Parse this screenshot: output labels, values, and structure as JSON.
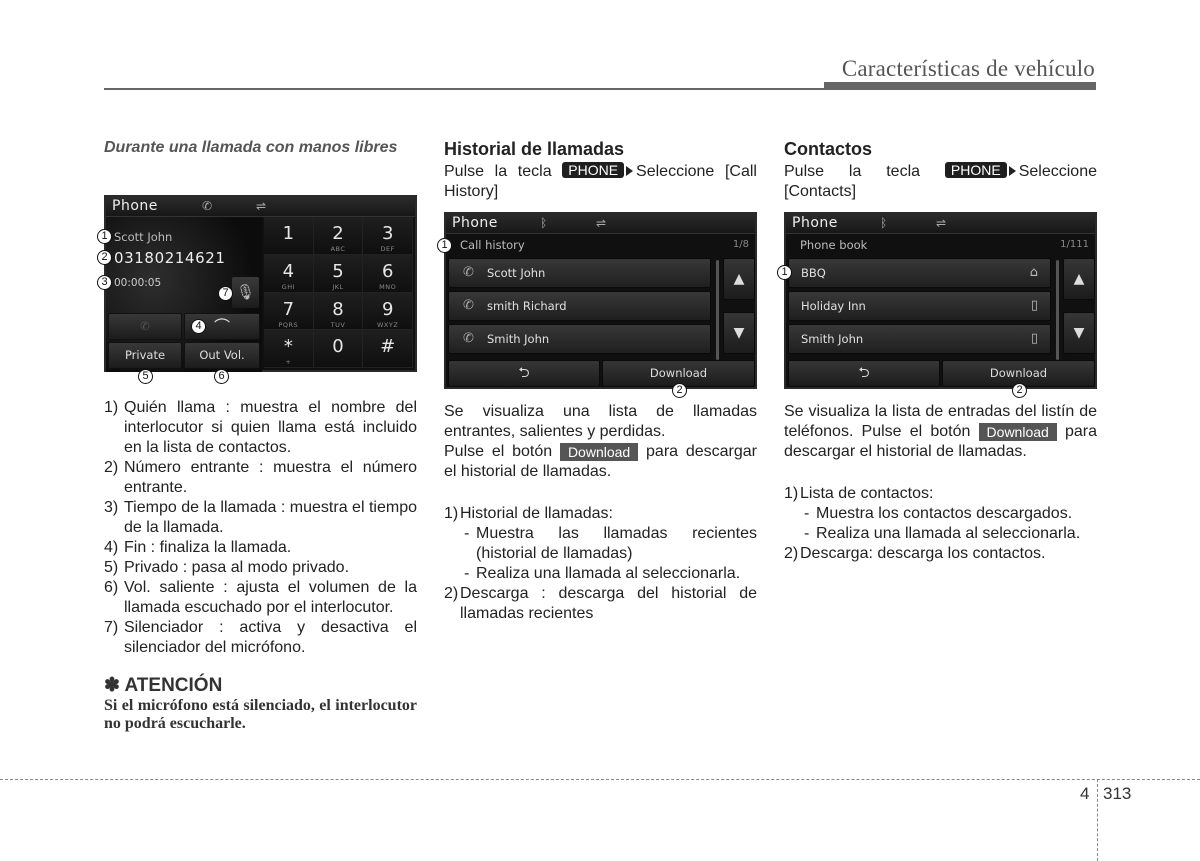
{
  "header": {
    "section_title": "Características de vehículo"
  },
  "col1": {
    "heading": "Durante una llamada con manos libres",
    "screen": {
      "title": "Phone",
      "caller_name": "Scott John",
      "caller_number": "03180214621",
      "call_time": "00:00:05",
      "buttons": {
        "private": "Private",
        "out_vol": "Out Vol."
      },
      "keypad": [
        {
          "digit": "1",
          "letters": ""
        },
        {
          "digit": "2",
          "letters": "ABC"
        },
        {
          "digit": "3",
          "letters": "DEF"
        },
        {
          "digit": "4",
          "letters": "GHI"
        },
        {
          "digit": "5",
          "letters": "JKL"
        },
        {
          "digit": "6",
          "letters": "MNO"
        },
        {
          "digit": "7",
          "letters": "PQRS"
        },
        {
          "digit": "8",
          "letters": "TUV"
        },
        {
          "digit": "9",
          "letters": "WXYZ"
        },
        {
          "digit": "*",
          "letters": "+"
        },
        {
          "digit": "0",
          "letters": ""
        },
        {
          "digit": "#",
          "letters": ""
        }
      ],
      "callouts": [
        "1",
        "2",
        "3",
        "4",
        "5",
        "6",
        "7"
      ]
    },
    "items": [
      {
        "n": "1)",
        "text": "Quién llama : muestra el nombre del interlocutor si quien llama está incluido en la lista de contactos."
      },
      {
        "n": "2)",
        "text": "Número entrante : muestra el número entrante."
      },
      {
        "n": "3)",
        "text": "Tiempo de la llamada : muestra el tiempo de la llamada."
      },
      {
        "n": "4)",
        "text": "Fin : finaliza la llamada."
      },
      {
        "n": "5)",
        "text": "Privado : pasa al modo privado."
      },
      {
        "n": "6)",
        "text": "Vol. saliente : ajusta el volumen de la llamada escuchado por el interlocutor."
      },
      {
        "n": "7)",
        "text": "Silenciador : activa y desactiva el silenciador del micrófono."
      }
    ],
    "attention": {
      "title": "✽ ATENCIÓN",
      "body": "Si el micrófono está silenciado, el interlocutor no podrá escucharle."
    }
  },
  "col2": {
    "heading": "Historial de llamadas",
    "intro_pre": "Pulse la tecla",
    "key": "PHONE",
    "intro_post": "Seleccione [Call History]",
    "screen": {
      "title": "Phone",
      "subtitle": "Call history",
      "count": "1/8",
      "rows": [
        "Scott John",
        "smith Richard",
        "Smith John"
      ],
      "download": "Download",
      "callouts": [
        "1",
        "2"
      ]
    },
    "desc1": "Se visualiza una lista de llamadas entrantes, salientes y perdidas.",
    "desc2_pre": "Pulse el botón",
    "desc2_btn": "Download",
    "desc2_post": "para descargar el historial de llamadas.",
    "items": [
      {
        "n": "1)",
        "text": "Historial de llamadas:",
        "subs": [
          "Muestra las llamadas recientes (historial de llamadas)",
          "Realiza una llamada al seleccionarla."
        ]
      },
      {
        "n": "2)",
        "text": "Descarga : descarga del historial de llamadas recientes"
      }
    ]
  },
  "col3": {
    "heading": "Contactos",
    "intro_pre": "Pulse la tecla",
    "key": "PHONE",
    "intro_post": "Seleccione [Contacts]",
    "screen": {
      "title": "Phone",
      "subtitle": "Phone book",
      "count": "1/111",
      "rows": [
        {
          "name": "BBQ",
          "icon": "home-icon"
        },
        {
          "name": "Holiday Inn",
          "icon": "mobile-icon"
        },
        {
          "name": "Smith John",
          "icon": "mobile-icon"
        }
      ],
      "download": "Download",
      "callouts": [
        "1",
        "2"
      ]
    },
    "desc_pre": "Se visualiza la lista de entradas del listín de teléfonos. Pulse el botón",
    "desc_btn": "Download",
    "desc_post": "para descargar el historial de llamadas.",
    "items": [
      {
        "n": "1)",
        "text": "Lista de contactos:",
        "subs": [
          "Muestra los contactos descargados.",
          "Realiza una llamada al seleccionarla."
        ]
      },
      {
        "n": "2)",
        "text": "Descarga: descarga los contactos."
      }
    ]
  },
  "footer": {
    "chapter": "4",
    "page": "313"
  }
}
